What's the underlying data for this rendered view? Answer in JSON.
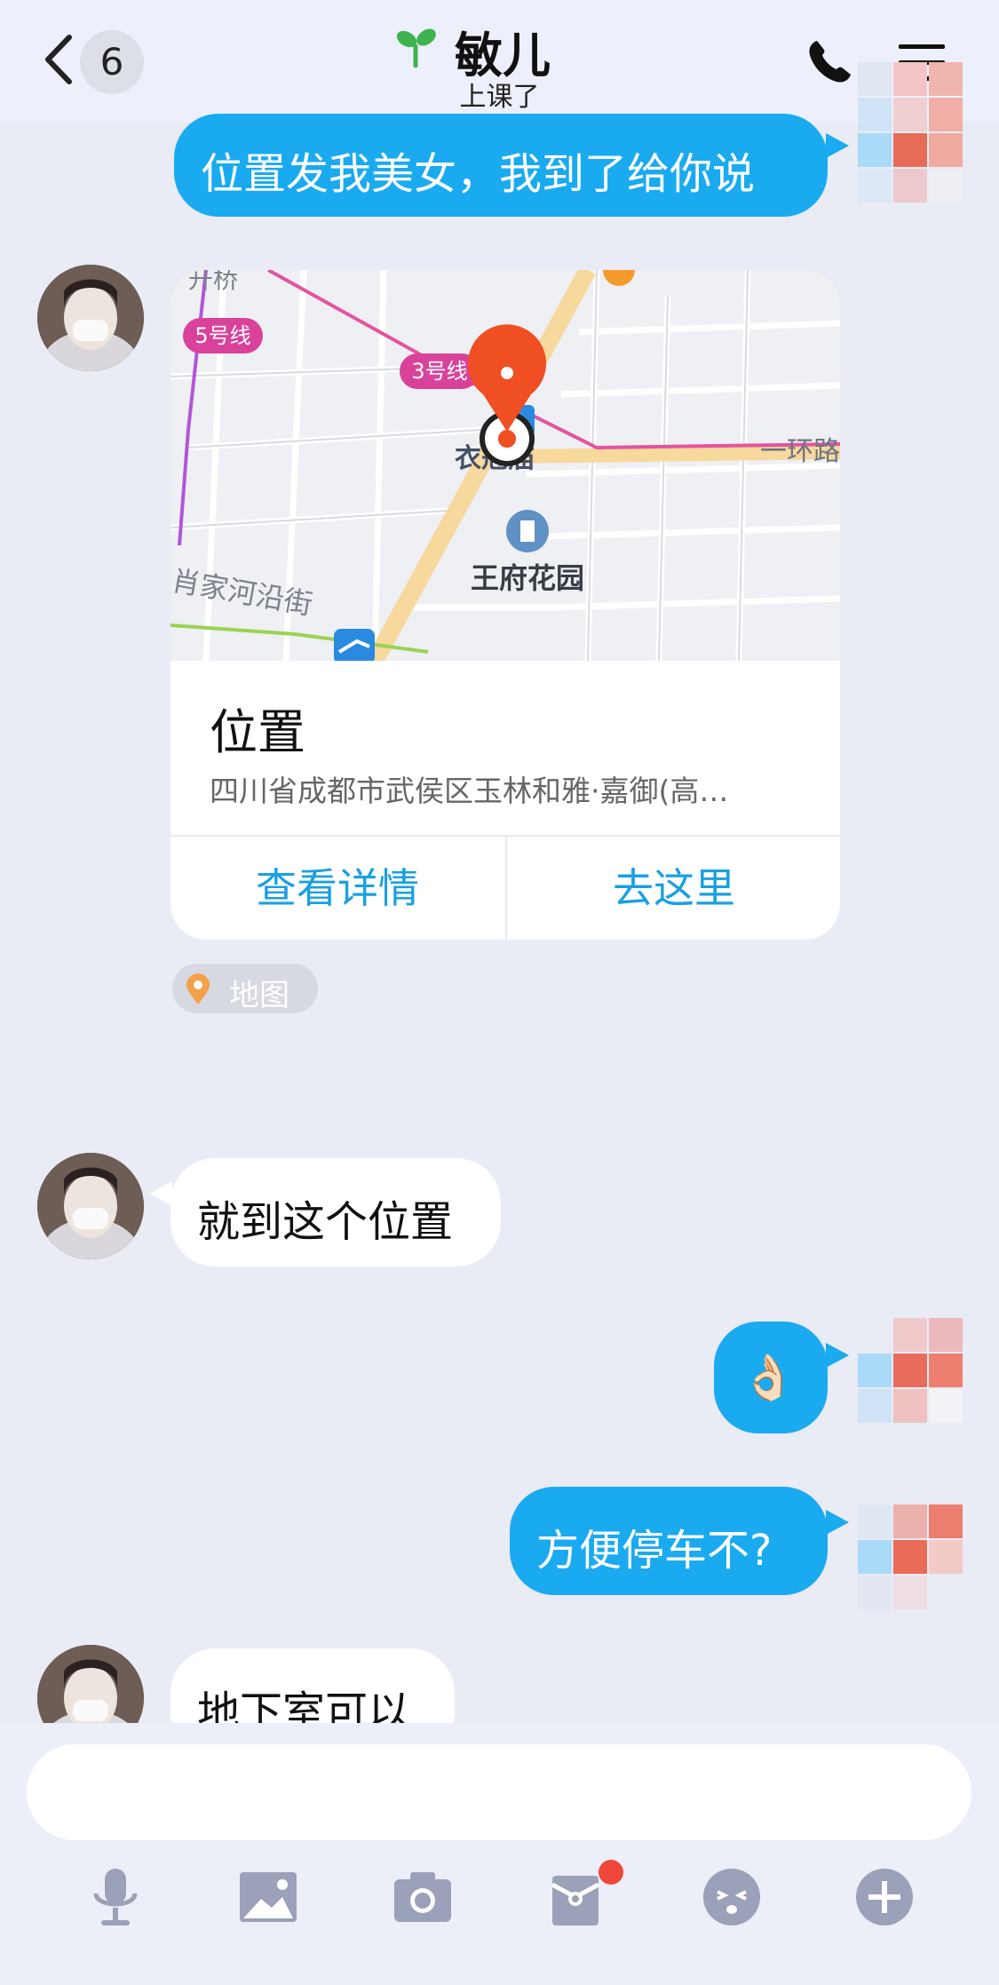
{
  "header": {
    "back_count": "6",
    "title": "敏儿",
    "subtitle": "上课了"
  },
  "messages": [
    {
      "side": "out",
      "text": "位置发我美女，我到了给你说"
    },
    {
      "side": "in",
      "type": "location"
    },
    {
      "side": "in",
      "text": "就到这个位置"
    },
    {
      "side": "out",
      "text": "👌🏻"
    },
    {
      "side": "out",
      "text": "方便停车不?"
    },
    {
      "side": "in",
      "text": "地下室可以"
    }
  ],
  "location_card": {
    "title": "位置",
    "address": "四川省成都市武侯区玉林和雅·嘉御(高…",
    "details_btn": "查看详情",
    "go_btn": "去这里",
    "tag": "地图",
    "map_labels": {
      "line5": "5号线",
      "line3": "3号线",
      "temple": "衣冠庙",
      "ring_road": "一环路",
      "garden": "王府花园",
      "street": "肖家河沿街",
      "top_left": "升桥"
    }
  },
  "colors": {
    "accent": "#1aaaf0",
    "pin": "#f04e23",
    "background": "#e9ebf5"
  },
  "toolbar": [
    "microphone-icon",
    "image-icon",
    "camera-icon",
    "red-packet-icon",
    "emoji-icon",
    "plus-icon"
  ]
}
